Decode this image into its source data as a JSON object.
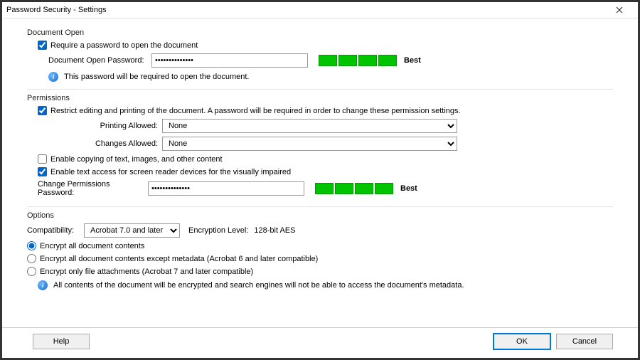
{
  "window": {
    "title": "Password Security - Settings"
  },
  "documentOpen": {
    "groupLabel": "Document Open",
    "requireLabel": "Require a password to open the document",
    "passwordLabel": "Document Open Password:",
    "passwordValue": "**************",
    "strengthLabel": "Best",
    "infoText": "This password will be required to open the document."
  },
  "permissions": {
    "groupLabel": "Permissions",
    "restrictLabel": "Restrict editing and printing of the document. A password will be required in order to change these permission settings.",
    "printingLabel": "Printing Allowed:",
    "printingValue": "None",
    "changesLabel": "Changes Allowed:",
    "changesValue": "None",
    "enableCopyLabel": "Enable copying of text, images, and other content",
    "enableAccessibilityLabel": "Enable text access for screen reader devices for the visually impaired",
    "changePwdLabel": "Change Permissions Password:",
    "changePwdValue": "**************",
    "strengthLabel": "Best"
  },
  "options": {
    "groupLabel": "Options",
    "compatLabel": "Compatibility:",
    "compatValue": "Acrobat 7.0 and later",
    "encLevelLabel": "Encryption  Level:",
    "encLevelValue": "128-bit AES",
    "radio1": "Encrypt all document contents",
    "radio2": "Encrypt all document contents except metadata (Acrobat 6 and later compatible)",
    "radio3": "Encrypt only file attachments (Acrobat 7 and later compatible)",
    "infoText": "All contents of the document will be encrypted and search engines will not be able to access the document's metadata."
  },
  "buttons": {
    "help": "Help",
    "ok": "OK",
    "cancel": "Cancel"
  }
}
